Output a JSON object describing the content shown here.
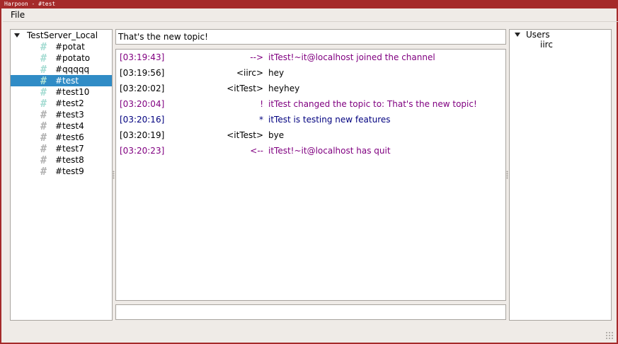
{
  "window": {
    "title": "Harpoon - #test"
  },
  "menu": {
    "file": "File"
  },
  "tree": {
    "server": "TestServer_Local",
    "channels": [
      {
        "name": "#potat",
        "icon": "channel-active-icon",
        "selected": false
      },
      {
        "name": "#potato",
        "icon": "channel-active-icon",
        "selected": false
      },
      {
        "name": "#qqqqq",
        "icon": "channel-active-icon",
        "selected": false
      },
      {
        "name": "#test",
        "icon": "channel-active-icon",
        "selected": true
      },
      {
        "name": "#test10",
        "icon": "channel-active-icon",
        "selected": false
      },
      {
        "name": "#test2",
        "icon": "channel-active-icon",
        "selected": false
      },
      {
        "name": "#test3",
        "icon": "channel-inactive-icon",
        "selected": false
      },
      {
        "name": "#test4",
        "icon": "channel-inactive-icon",
        "selected": false
      },
      {
        "name": "#test6",
        "icon": "channel-inactive-icon",
        "selected": false
      },
      {
        "name": "#test7",
        "icon": "channel-inactive-icon",
        "selected": false
      },
      {
        "name": "#test8",
        "icon": "channel-inactive-icon",
        "selected": false
      },
      {
        "name": "#test9",
        "icon": "channel-inactive-icon",
        "selected": false
      }
    ]
  },
  "topic": "That's the new topic!",
  "messages": [
    {
      "ts": "[03:19:43]",
      "src": "-->",
      "text": "itTest!~it@localhost joined the channel",
      "color": "#800080"
    },
    {
      "ts": "[03:19:56]",
      "src": "<iirc>",
      "text": "hey",
      "color": "#000000"
    },
    {
      "ts": "[03:20:02]",
      "src": "<itTest>",
      "text": "heyhey",
      "color": "#000000"
    },
    {
      "ts": "[03:20:04]",
      "src": "!",
      "text": "itTest changed the topic to: That's the new topic!",
      "color": "#800080"
    },
    {
      "ts": "[03:20:16]",
      "src": "*",
      "text": "itTest is testing new features",
      "color": "#00007f"
    },
    {
      "ts": "[03:20:19]",
      "src": "<itTest>",
      "text": "bye",
      "color": "#000000"
    },
    {
      "ts": "[03:20:23]",
      "src": "<--",
      "text": "itTest!~it@localhost has quit",
      "color": "#800080"
    }
  ],
  "users": {
    "header": "Users",
    "list": [
      "iirc"
    ]
  },
  "input": {
    "value": ""
  }
}
